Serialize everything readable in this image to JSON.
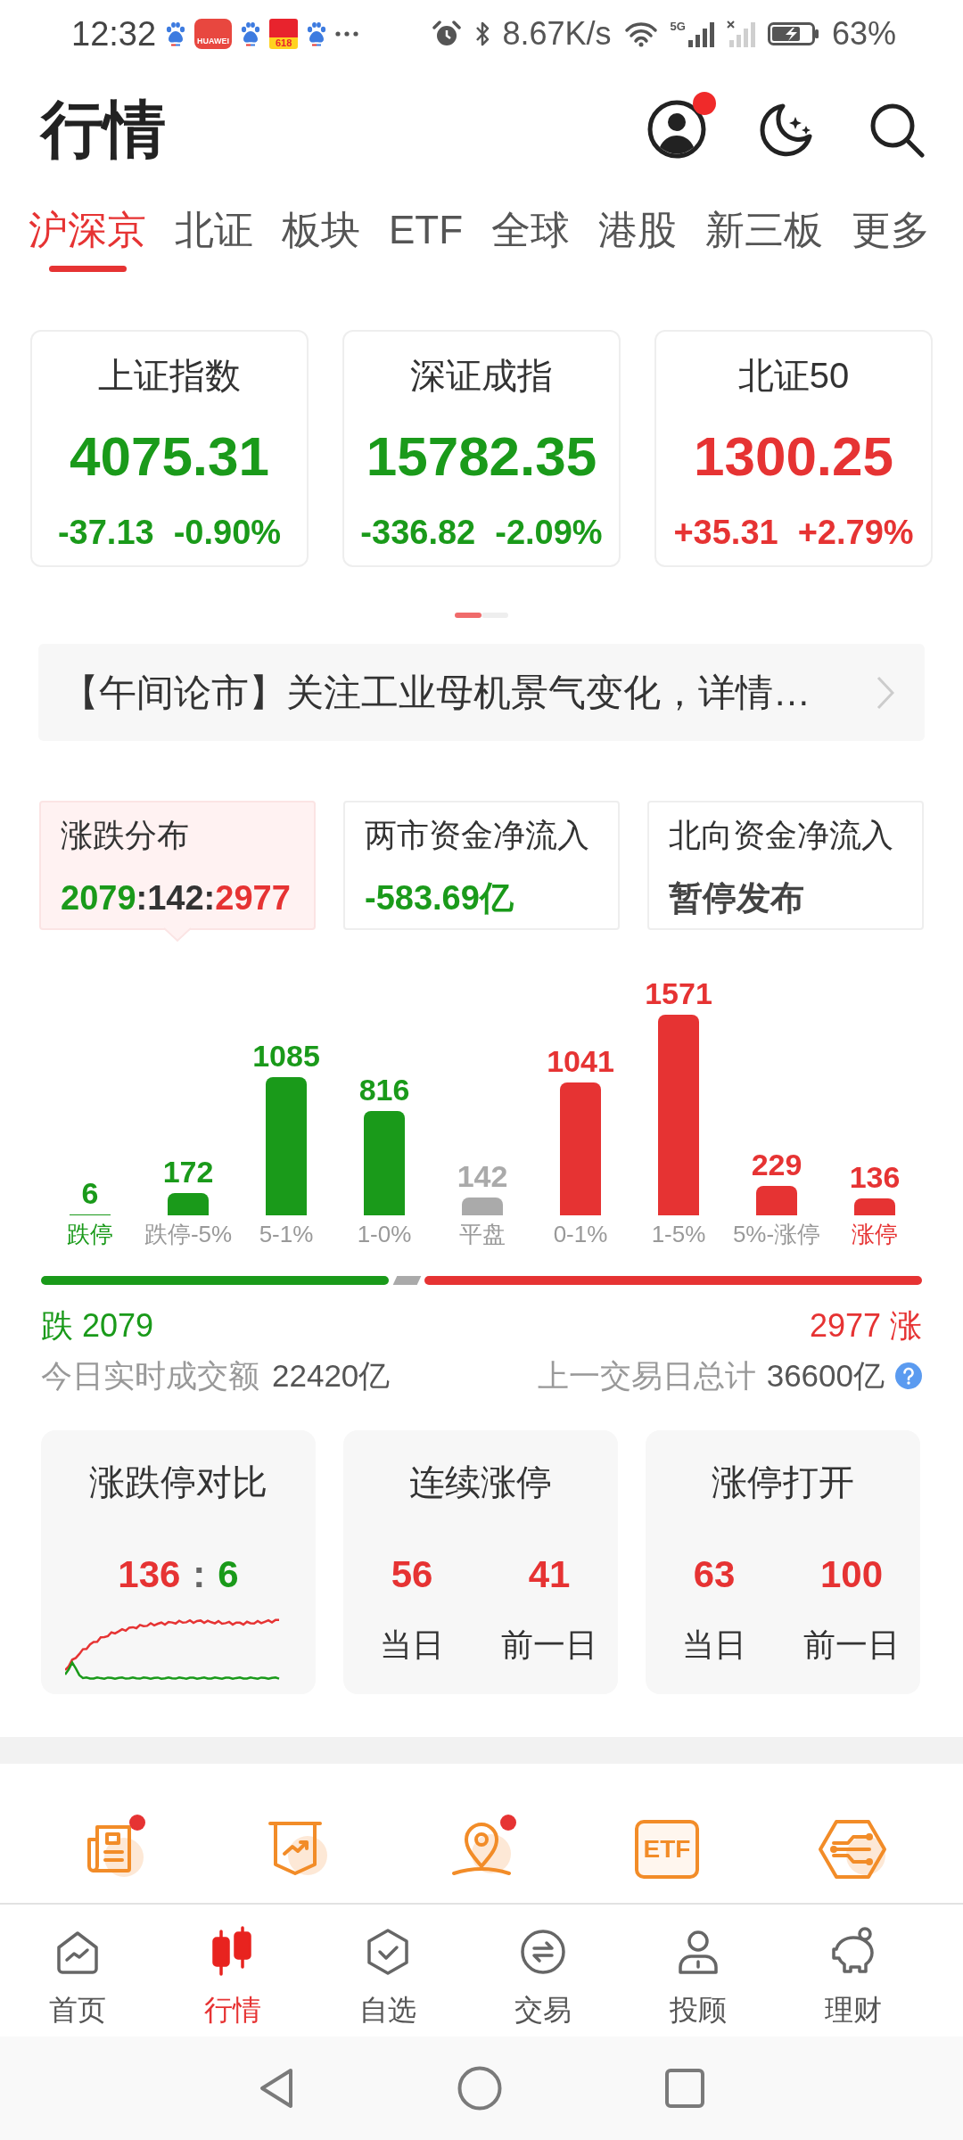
{
  "status_bar": {
    "time": "12:32",
    "store_tile_text": "HUAWEI",
    "shopping_tile_text": "618",
    "net_speed": "8.67K/s",
    "network_type": "5G",
    "battery": "63%"
  },
  "header": {
    "title": "行情",
    "profile_badge": true
  },
  "market_tabs": [
    {
      "label": "沪深京",
      "selected": true
    },
    {
      "label": "北证",
      "selected": false
    },
    {
      "label": "板块",
      "selected": false
    },
    {
      "label": "ETF",
      "selected": false
    },
    {
      "label": "全球",
      "selected": false
    },
    {
      "label": "港股",
      "selected": false
    },
    {
      "label": "新三板",
      "selected": false
    },
    {
      "label": "更多",
      "selected": false
    }
  ],
  "index_cards": [
    {
      "name": "上证指数",
      "value": "4075.31",
      "change": "-37.13",
      "change_percent": "-0.90%",
      "color": "#1a9a1a"
    },
    {
      "name": "深证成指",
      "value": "15782.35",
      "change": "-336.82",
      "change_percent": "-2.09%",
      "color": "#1a9a1a"
    },
    {
      "name": "北证50",
      "value": "1300.25",
      "change": "+35.31",
      "change_percent": "+2.79%",
      "color": "#e63333"
    }
  ],
  "index_pages": [
    {
      "selected": true
    },
    {
      "selected": false
    }
  ],
  "news_banner": {
    "text": "【午间论市】关注工业母机景气变化，详情…"
  },
  "stat_tabs": [
    {
      "title": "涨跌分布",
      "selected": true,
      "value_parts": [
        {
          "text": "2079",
          "color": "#1a9a1a"
        },
        {
          "text": ":142:",
          "color": "#333333"
        },
        {
          "text": "2977",
          "color": "#e63333"
        }
      ]
    },
    {
      "title": "两市资金净流入",
      "selected": false,
      "value_parts": [
        {
          "text": "-583.69亿",
          "color": "#1a9a1a"
        }
      ]
    },
    {
      "title": "北向资金净流入",
      "selected": false,
      "value_parts": [
        {
          "text": "暂停发布",
          "color": "#444444"
        }
      ]
    }
  ],
  "distribution": {
    "chart_data": {
      "type": "bar",
      "categories": [
        "跌停",
        "跌停-5%",
        "5-1%",
        "1-0%",
        "平盘",
        "0-1%",
        "1-5%",
        "5%-涨停",
        "涨停"
      ],
      "values": [
        6,
        172,
        1085,
        816,
        142,
        1041,
        1571,
        229,
        136
      ],
      "data_labels": true
    },
    "bars": [
      {
        "color": "#1a9a1a"
      },
      {
        "color": "#1a9a1a"
      },
      {
        "color": "#1a9a1a"
      },
      {
        "color": "#1a9a1a"
      },
      {
        "color": "#aaaaaa"
      },
      {
        "color": "#e63333"
      },
      {
        "color": "#e63333"
      },
      {
        "color": "#e63333"
      },
      {
        "color": "#e63333"
      }
    ],
    "category_labels": [
      {
        "color": "#1a9a1a"
      },
      {
        "color": "#999999"
      },
      {
        "color": "#999999"
      },
      {
        "color": "#999999"
      },
      {
        "color": "#999999"
      },
      {
        "color": "#999999"
      },
      {
        "color": "#999999"
      },
      {
        "color": "#999999"
      },
      {
        "color": "#e63333"
      }
    ]
  },
  "breadth_bar": {
    "fall_text": "跌 2079",
    "rise_text": "2977 涨"
  },
  "turnover": {
    "today_label": "今日实时成交额",
    "today_value": "22420亿",
    "previous_label": "上一交易日总计",
    "previous_value": "36600亿"
  },
  "limit_cards": [
    {
      "title": "涨跌停对比",
      "kind": "ratio",
      "ratio_parts": [
        {
          "text": "136",
          "color": "#e63333"
        },
        {
          "text": ":",
          "color": "#666666"
        },
        {
          "text": "6",
          "color": "#1a9a1a"
        }
      ]
    },
    {
      "title": "连续涨停",
      "kind": "pair",
      "items": [
        {
          "value": "56",
          "label": "当日",
          "color": "#e63333"
        },
        {
          "value": "41",
          "label": "前一日",
          "color": "#e63333"
        }
      ]
    },
    {
      "title": "涨停打开",
      "kind": "pair",
      "items": [
        {
          "value": "63",
          "label": "当日",
          "color": "#e63333"
        },
        {
          "value": "100",
          "label": "前一日",
          "color": "#e63333"
        }
      ]
    }
  ],
  "shortcuts": [
    {
      "badge": true
    },
    {
      "badge": false
    },
    {
      "badge": true
    },
    {
      "badge": false,
      "text": "ETF"
    },
    {
      "badge": false
    }
  ],
  "bottom_nav": [
    {
      "label": "首页",
      "selected": false
    },
    {
      "label": "行情",
      "selected": true
    },
    {
      "label": "自选",
      "selected": false
    },
    {
      "label": "交易",
      "selected": false
    },
    {
      "label": "投顾",
      "selected": false
    },
    {
      "label": "理财",
      "selected": false
    }
  ]
}
